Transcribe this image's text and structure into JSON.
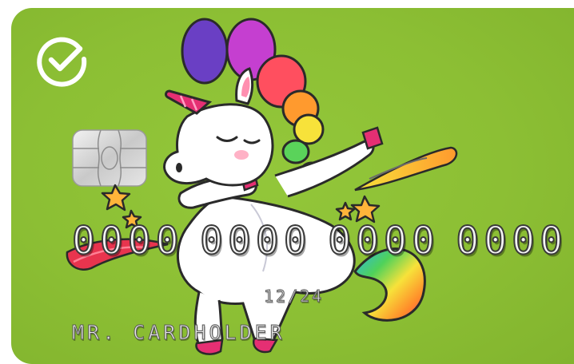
{
  "card": {
    "number_groups": [
      "0000",
      "0000",
      "0000",
      "0000"
    ],
    "expiry": "12/24",
    "holder": "MR. CARDHOLDER",
    "logo_icon": "sber-checkmark-logo-icon",
    "chip_icon": "emv-chip-icon",
    "illustration": "dabbing-rainbow-unicorn",
    "colors": {
      "background": "#8cbf34",
      "logo": "#ffffff",
      "text": "#f4f4f4"
    }
  }
}
